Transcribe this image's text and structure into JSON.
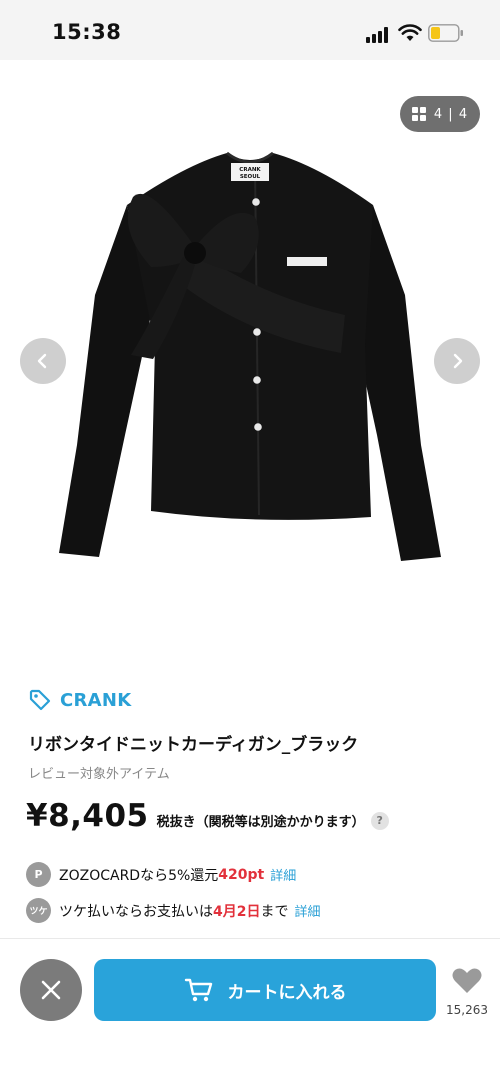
{
  "status": {
    "time": "15:38"
  },
  "gallery": {
    "page_indicator": "4 | 4"
  },
  "product_image": {
    "label_line1": "CRANK",
    "label_line2": "SEOUL"
  },
  "brand": {
    "name": "CRANK"
  },
  "product": {
    "name": "リボンタイドニットカーディガン_ブラック",
    "review_note": "レビュー対象外アイテム",
    "price": "¥8,405",
    "tax_note": "税抜き（関税等は別途かかります）",
    "help": "?"
  },
  "benefits": [
    {
      "icon": "P",
      "text": "ZOZOCARDなら5%還元 ",
      "highlight": "420pt",
      "link": "詳細"
    },
    {
      "icon": "ツケ",
      "text": "ツケ払いならお支払いは",
      "highlight": "4月2日",
      "suffix": "まで",
      "link": "詳細"
    }
  ],
  "actions": {
    "cart_label": "カートに入れる",
    "favorite_count": "15,263"
  },
  "colors": {
    "accent": "#29a3da",
    "highlight": "#e2313b"
  }
}
